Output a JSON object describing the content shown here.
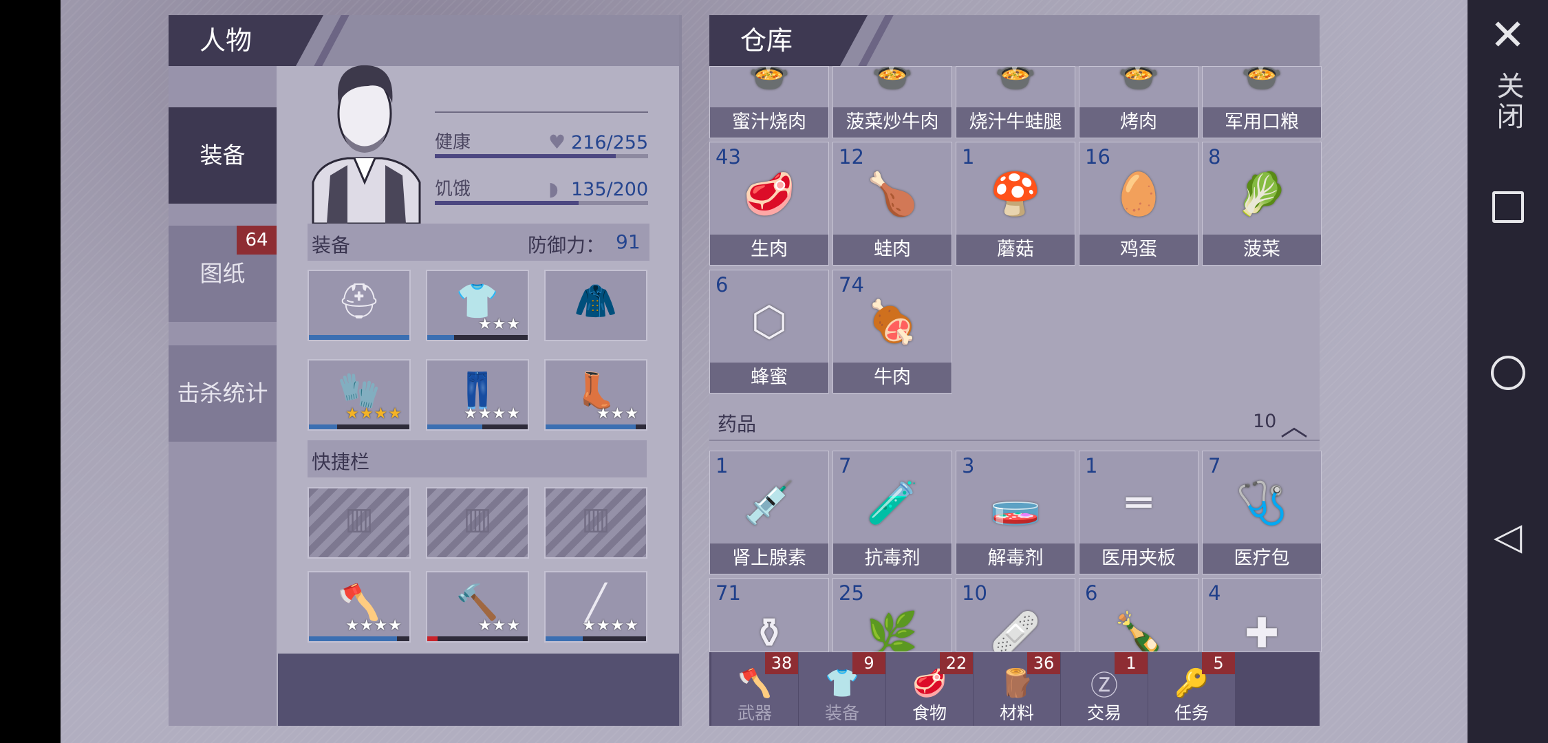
{
  "character": {
    "title": "人物",
    "tabs": [
      {
        "label": "装备",
        "active": true
      },
      {
        "label": "图纸",
        "badge": "64"
      },
      {
        "label": "击杀统计"
      }
    ],
    "stats": {
      "health_label": "健康",
      "health_value": "216/255",
      "health_fraction": 0.847,
      "hunger_label": "饥饿",
      "hunger_value": "135/200",
      "hunger_fraction": 0.675
    },
    "equipment_label": "装备",
    "defense_label": "防御力：",
    "defense_value": "91",
    "equipment_slots": [
      {
        "icon": "santa-hat-icon",
        "stars": "",
        "durability": 1.0
      },
      {
        "icon": "shirt-icon",
        "stars": "★★★",
        "durability": 0.27
      },
      {
        "icon": "jacket-icon",
        "stars": "",
        "durability": null
      },
      {
        "icon": "gloves-icon",
        "stars": "★★★★",
        "durability": 0.28,
        "gold": true
      },
      {
        "icon": "pants-icon",
        "stars": "★★★★",
        "durability": 0.55
      },
      {
        "icon": "boots-icon",
        "stars": "★★★",
        "durability": 0.9
      }
    ],
    "quickbar_label": "快捷栏",
    "quickbar_slots": [
      {
        "icon": "axe-icon",
        "stars": "★★★★",
        "durability": 0.88,
        "color": "#3b6fb2"
      },
      {
        "icon": "hammer-icon",
        "stars": "★★★",
        "durability": 0.1,
        "color": "#c8232b"
      },
      {
        "icon": "baton-icon",
        "stars": "★★★★",
        "durability": 0.37,
        "color": "#3b6fb2"
      }
    ]
  },
  "warehouse": {
    "title": "仓库",
    "food_top_row": [
      "蜜汁烧肉",
      "菠菜炒牛肉",
      "烧汁牛蛙腿",
      "烤肉",
      "军用口粮"
    ],
    "food_items": [
      {
        "count": "43",
        "label": "生肉",
        "icon": "steak-icon"
      },
      {
        "count": "12",
        "label": "蛙肉",
        "icon": "frog-leg-icon"
      },
      {
        "count": "1",
        "label": "蘑菇",
        "icon": "mushroom-icon"
      },
      {
        "count": "16",
        "label": "鸡蛋",
        "icon": "egg-icon"
      },
      {
        "count": "8",
        "label": "菠菜",
        "icon": "spinach-icon"
      },
      {
        "count": "6",
        "label": "蜂蜜",
        "icon": "honeycomb-icon"
      },
      {
        "count": "74",
        "label": "牛肉",
        "icon": "beef-icon"
      }
    ],
    "medicine_header": "药品",
    "medicine_count": "10",
    "medicine_items": [
      {
        "count": "1",
        "label": "肾上腺素",
        "icon": "syringe-icon"
      },
      {
        "count": "7",
        "label": "抗毒剂",
        "icon": "vial-icon"
      },
      {
        "count": "3",
        "label": "解毒剂",
        "icon": "test-tube-icon"
      },
      {
        "count": "1",
        "label": "医用夹板",
        "icon": "splint-icon"
      },
      {
        "count": "7",
        "label": "医疗包",
        "icon": "medkit-icon"
      }
    ],
    "medicine_partial": [
      {
        "count": "71",
        "icon": "mortar-icon"
      },
      {
        "count": "25",
        "icon": "herb-icon"
      },
      {
        "count": "10",
        "icon": "bandage-icon"
      },
      {
        "count": "6",
        "icon": "bottle-icon"
      },
      {
        "count": "4",
        "icon": "first-aid-icon"
      }
    ],
    "bottom_tabs": [
      {
        "label": "武器",
        "badge": "38",
        "icon": "axe-icon",
        "dim": true
      },
      {
        "label": "装备",
        "badge": "9",
        "icon": "shirt-icon",
        "dim": true
      },
      {
        "label": "食物",
        "badge": "22",
        "icon": "steak-icon",
        "dim": false
      },
      {
        "label": "材料",
        "badge": "36",
        "icon": "plank-icon",
        "dim": false
      },
      {
        "label": "交易",
        "badge": "1",
        "icon": "coin-icon",
        "dim": false
      },
      {
        "label": "任务",
        "badge": "5",
        "icon": "key-icon",
        "dim": false
      }
    ]
  },
  "close_label": "关闭"
}
